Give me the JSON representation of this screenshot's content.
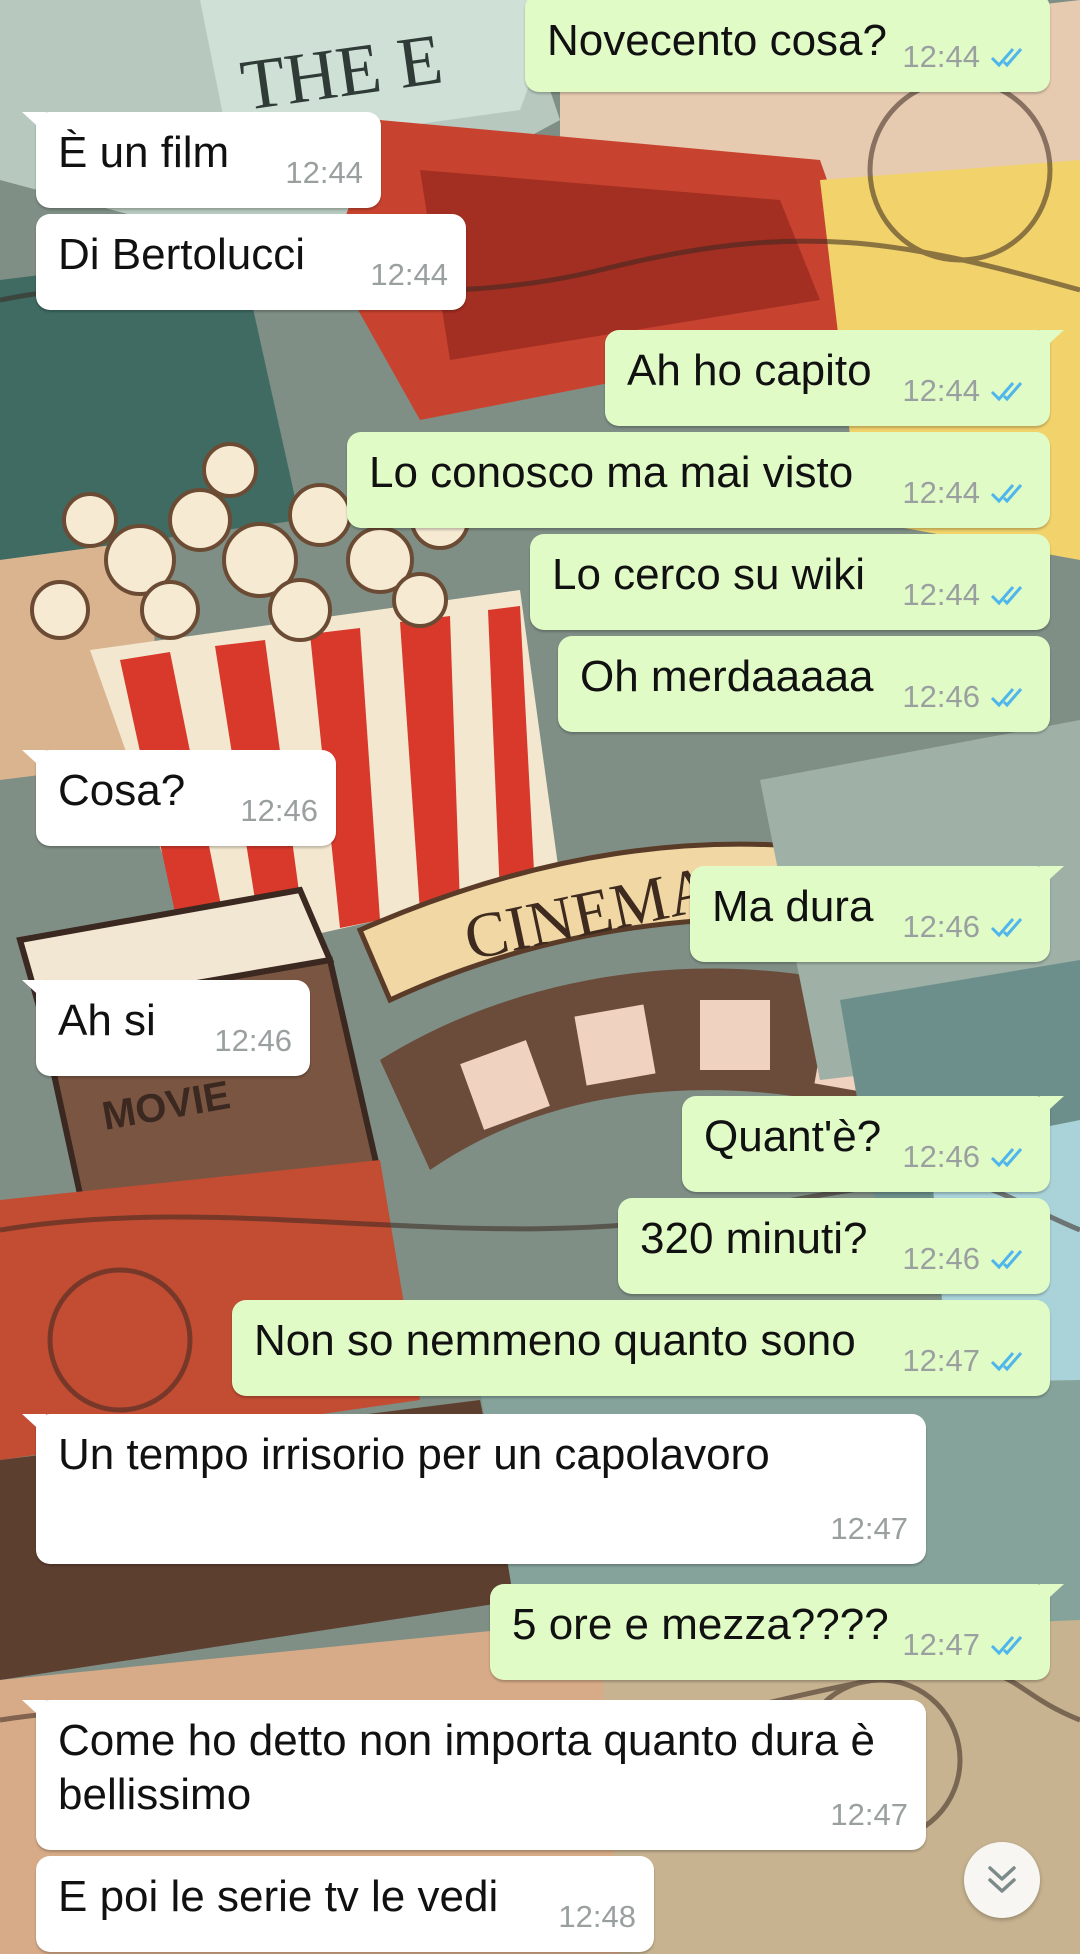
{
  "messages": [
    {
      "dir": "out",
      "text": "Novecento cosa?",
      "time": "12:44",
      "status": "read"
    },
    {
      "dir": "in",
      "text": "È un film",
      "time": "12:44"
    },
    {
      "dir": "in",
      "text": "Di Bertolucci",
      "time": "12:44"
    },
    {
      "dir": "out",
      "text": "Ah ho capito",
      "time": "12:44",
      "status": "read"
    },
    {
      "dir": "out",
      "text": "Lo conosco ma mai visto",
      "time": "12:44",
      "status": "read"
    },
    {
      "dir": "out",
      "text": "Lo cerco su wiki",
      "time": "12:44",
      "status": "read"
    },
    {
      "dir": "out",
      "text": "Oh merdaaaaa",
      "time": "12:46",
      "status": "read"
    },
    {
      "dir": "in",
      "text": "Cosa?",
      "time": "12:46"
    },
    {
      "dir": "out",
      "text": "Ma dura",
      "time": "12:46",
      "status": "read"
    },
    {
      "dir": "in",
      "text": "Ah si",
      "time": "12:46"
    },
    {
      "dir": "out",
      "text": "Quant'è?",
      "time": "12:46",
      "status": "read"
    },
    {
      "dir": "out",
      "text": "320 minuti?",
      "time": "12:46",
      "status": "read"
    },
    {
      "dir": "out",
      "text": "Non so nemmeno quanto sono",
      "time": "12:47",
      "status": "read"
    },
    {
      "dir": "in",
      "text": "Un tempo irrisorio per un capolavoro",
      "time": "12:47"
    },
    {
      "dir": "out",
      "text": "5 ore e mezza????",
      "time": "12:47",
      "status": "read"
    },
    {
      "dir": "in",
      "text": "Come ho detto non importa quanto dura è bellissimo",
      "time": "12:47"
    },
    {
      "dir": "in",
      "text": "E poi le serie tv le vedi",
      "time": "12:48"
    }
  ],
  "wallpaper": {
    "banner_top": "THE E",
    "banner_cinema": "CINEMA",
    "clapper": "MOVIE"
  },
  "colors": {
    "outgoing_bubble": "#e1fbc7",
    "incoming_bubble": "#ffffff",
    "read_ticks": "#4fb6ec",
    "timestamp": "#9aa0a0"
  },
  "icons": {
    "read_status": "double-check-icon",
    "scroll_down": "double-chevron-down-icon"
  }
}
